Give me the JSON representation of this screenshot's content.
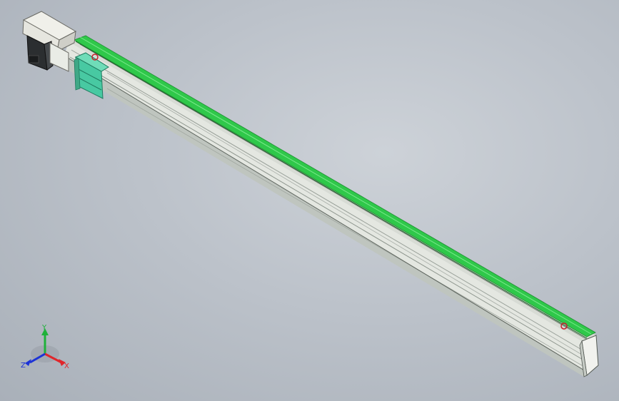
{
  "viewport": {
    "background_top": "#cdd2d8",
    "background_bottom": "#a9b0b9"
  },
  "model": {
    "rail_green": "#2fc84a",
    "rail_green_dark": "#1b8f2f",
    "profile_light": "#e9ece6",
    "profile_mid": "#c9cec8",
    "profile_shadow": "#9ea59f",
    "motor_housing": "#e6e6df",
    "motor_dark": "#2b2e30",
    "carriage_color": "#48c9a2",
    "marker_color": "#c8202a"
  },
  "triad": {
    "x_label": "X",
    "y_label": "Y",
    "z_label": "Z",
    "x_color": "#e0262b",
    "y_color": "#1fb13a",
    "z_color": "#1d33d6"
  }
}
